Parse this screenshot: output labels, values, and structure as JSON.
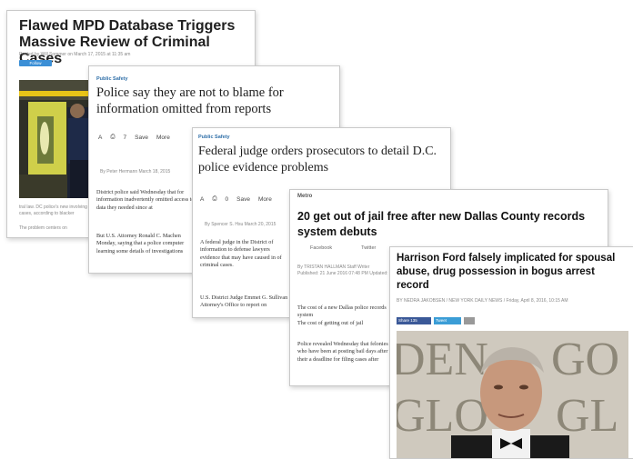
{
  "card1": {
    "title": "Flawed MPD Database Triggers Massive Review of Criminal Cases",
    "byline": "Posted by Will Sommer on March 17, 2015 at 11:35 am",
    "follow_label": "Follow @willsommer",
    "snippet1": "tral law. DC police's new involving cases, according to blacker",
    "snippet2": "The problem centers on"
  },
  "card2": {
    "kicker": "Public Safety",
    "title": "Police say they are not to blame for information omitted from reports",
    "toolbar": [
      "A",
      "Print",
      "7",
      "Save",
      "More"
    ],
    "byline": "By Peter Hermann   March 18, 2015",
    "p1": "District police said Wednesday that for information inadvertently omitted access to data they needed since at",
    "p2": "But U.S. Attorney Ronald C. Machen Monday, saying that a police computer learning some details of investigations"
  },
  "card3": {
    "kicker": "Public Safety",
    "title": "Federal judge orders prosecutors to detail D.C. police evidence problems",
    "toolbar": [
      "A",
      "Print",
      "0",
      "Save",
      "More"
    ],
    "byline": "By Spencer S. Hsu   March 20, 2015",
    "p1": "A federal judge in the District of information to defense lawyers evidence that may have caused in of criminal cases.",
    "p2": "U.S. District Judge Emmet G. Sullivan Attorney's Office to report on"
  },
  "card4": {
    "kicker": "Metro",
    "title": "20 get out of jail free after new Dallas County records system debuts",
    "social": [
      "Facebook",
      "Twitter"
    ],
    "byline": "By TRISTAN HALLMAN  Staff Writer",
    "byline2": "Published: 21 June 2016 07:48 PM  Updated: 22 June 2016 05:21 PM",
    "p1": "The cost of a new Dallas police records system",
    "p2": "The cost of getting out of jail",
    "p3": "Police revealed Wednesday that felonies — who have been at posting bail days after their a deadline for filing cases after"
  },
  "card5": {
    "title": "Harrison Ford falsely implicated for spousal abuse, drug possession in bogus arrest record",
    "byline": "BY NEDRA JAKOBSEN / NEW YORK DAILY NEWS / Friday, April 8, 2016, 10:15 AM",
    "share_fb": "Share 135",
    "share_tw": "Tweet",
    "photo_alt": "Harrison Ford"
  },
  "colors": {
    "kicker_blue": "#2f6fa8",
    "follow_blue": "#3b8fd6",
    "facebook": "#3b5998",
    "twitter": "#3b9dd6"
  }
}
